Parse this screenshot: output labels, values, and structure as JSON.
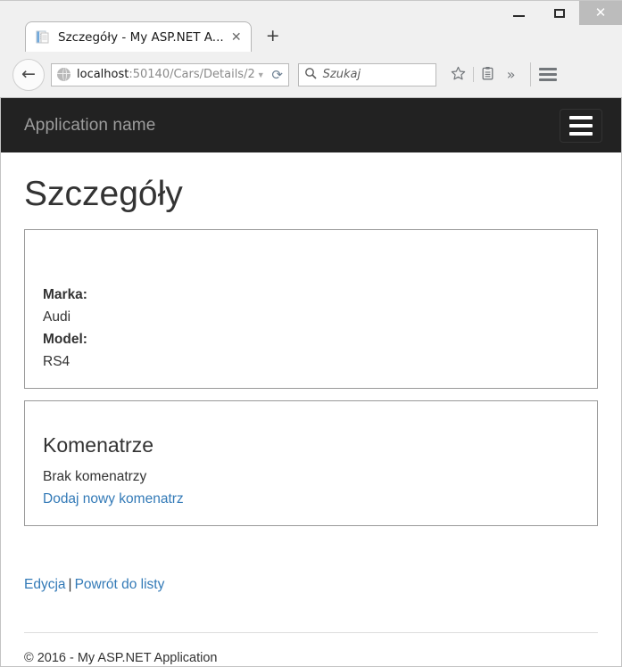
{
  "browser": {
    "window_controls": {
      "minimize": "minimize-button",
      "maximize": "maximize-button",
      "close_glyph": "✕"
    },
    "tab": {
      "title": "Szczegóły - My ASP.NET A...",
      "close_glyph": "✕",
      "new_tab_glyph": "+"
    },
    "toolbar": {
      "back_glyph": "←",
      "url_host": "localhost",
      "url_path": ":50140/Cars/Details/2",
      "url_full": "localhost:50140/Cars/Details/2",
      "dropdown_glyph": "▼",
      "reload_glyph": "⟳",
      "search_glyph": "⌕",
      "search_placeholder": "Szukaj",
      "search_value": "",
      "bookmark_glyph": "☆",
      "readinglist_glyph": "▤",
      "overflow_glyph": "»"
    }
  },
  "page": {
    "navbar": {
      "brand": "Application name"
    },
    "title": "Szczegóły",
    "details": {
      "fields": [
        {
          "label": "Marka:",
          "value": "Audi"
        },
        {
          "label": "Model:",
          "value": "RS4"
        }
      ]
    },
    "comments": {
      "heading": "Komenatrze",
      "empty_text": "Brak komenatrzy",
      "add_link": "Dodaj nowy komenatrz"
    },
    "actions": {
      "edit_link": "Edycja",
      "separator": "|",
      "back_link": "Powrót do listy"
    },
    "footer": {
      "copyright": "© 2016 - My ASP.NET Application"
    }
  },
  "colors": {
    "navbar_bg": "#222222",
    "brand_text": "#9d9d9d",
    "link": "#337ab7",
    "body_text": "#333333",
    "panel_border": "#999999"
  }
}
